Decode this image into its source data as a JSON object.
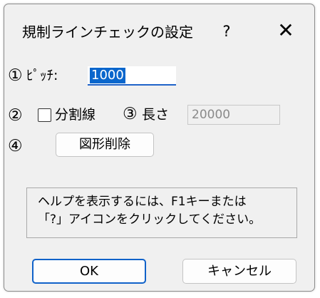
{
  "dialog": {
    "title": "規制ラインチェックの設定",
    "help_label": "?",
    "close_label": "✕"
  },
  "pitch": {
    "marker": "①",
    "label": "ﾋﾟｯﾁ:",
    "value": "1000"
  },
  "division": {
    "marker": "②",
    "checked": false,
    "label": "分割線"
  },
  "length": {
    "marker": "③",
    "label": "長さ",
    "value": "20000",
    "disabled": true
  },
  "delete_shapes": {
    "marker": "④",
    "label": "図形削除"
  },
  "help_text": {
    "line1": "ヘルプを表示するには、F1キーまたは",
    "line2": "「?」アイコンをクリックしてください。"
  },
  "buttons": {
    "ok": "OK",
    "cancel": "キャンセル"
  },
  "colors": {
    "accent": "#1062c9",
    "selection": "#0a66cc",
    "dialog_bg": "#f0f0f0"
  }
}
